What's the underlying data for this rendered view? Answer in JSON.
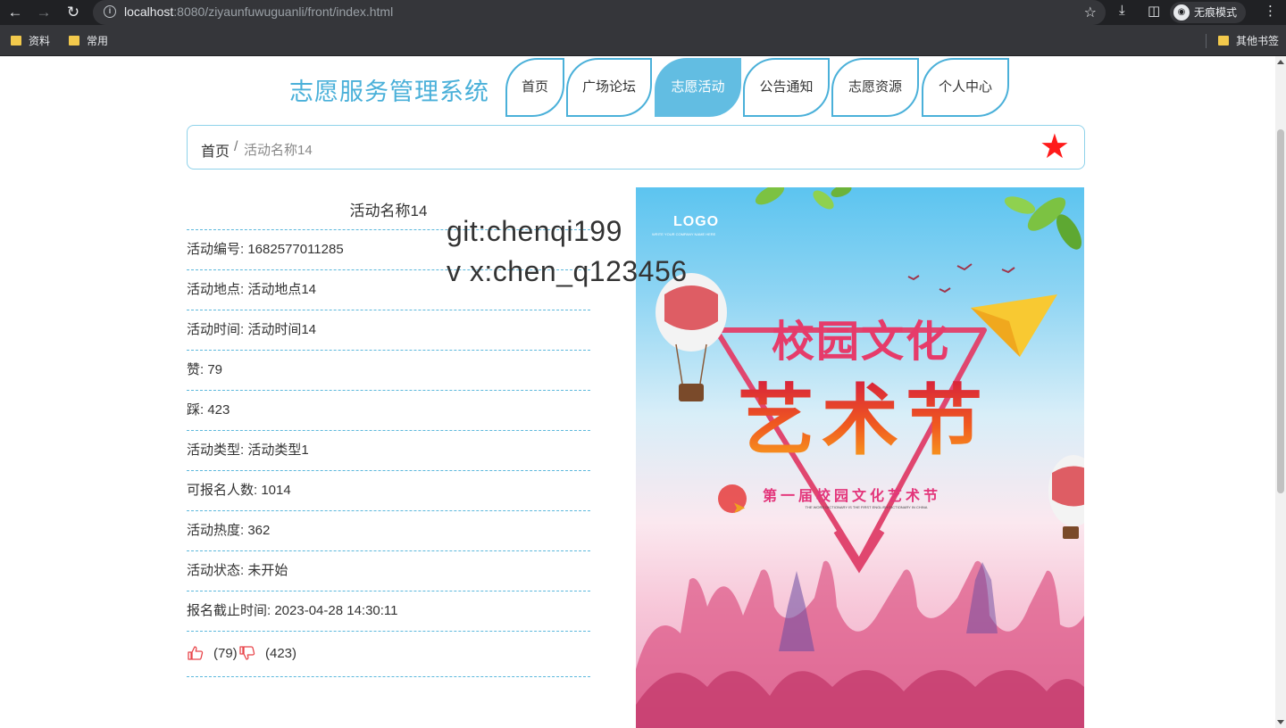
{
  "browser": {
    "url_host": "localhost",
    "url_rest": ":8080/ziyaunfuwuguanli/front/index.html",
    "incognito_label": "无痕模式",
    "bookmarks": [
      "资料",
      "常用"
    ],
    "other_bookmarks": "其他书签"
  },
  "site": {
    "title": "志愿服务管理系统"
  },
  "nav": {
    "items": [
      "首页",
      "广场论坛",
      "志愿活动",
      "公告通知",
      "志愿资源",
      "个人中心"
    ],
    "active": "志愿活动"
  },
  "breadcrumb": {
    "home": "首页",
    "separator": "/",
    "current": "活动名称14"
  },
  "detail": {
    "title": "活动名称14",
    "rows": [
      "活动编号: 1682577011285",
      "活动地点: 活动地点14",
      "活动时间: 活动时间14",
      "赞: 79",
      "踩: 423",
      "活动类型: 活动类型1",
      "可报名人数: 1014",
      "活动热度: 362",
      "活动状态: 未开始",
      "报名截止时间: 2023-04-28 14:30:11"
    ],
    "like_count": "(79)",
    "dislike_count": "(423)"
  },
  "watermark": {
    "line1": "git:chenqi199",
    "line2": "v x:chen_q123456"
  },
  "poster": {
    "logo": "LOGO",
    "logo_sub": "WRITE YOUR COMPANY NAME HERE",
    "title_line1": "校园文化",
    "title_line2": "艺术节",
    "subtitle": "第一届校园文化艺术节",
    "small_text": "THE WORD DICTIONARY IS THE FIRST ENGLISH DICTIONARY IN CHINA"
  },
  "colors": {
    "accent": "#4ab0d9",
    "active_tab": "#62bde2",
    "star": "#ff1a1a",
    "thumb": "#e8454a"
  }
}
